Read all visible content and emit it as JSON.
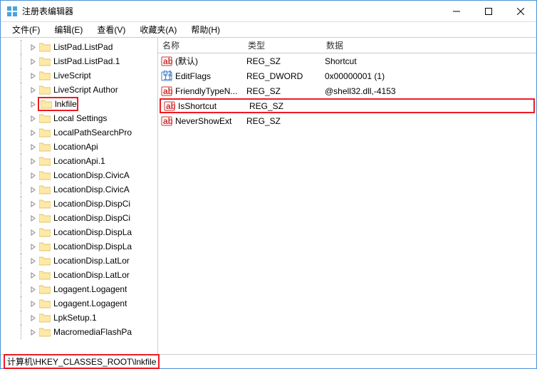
{
  "window": {
    "title": "注册表编辑器"
  },
  "menu": {
    "file": "文件(F)",
    "edit": "编辑(E)",
    "view": "查看(V)",
    "fav": "收藏夹(A)",
    "help": "帮助(H)"
  },
  "tree": [
    {
      "label": "ListPad.ListPad",
      "selected": false
    },
    {
      "label": "ListPad.ListPad.1",
      "selected": false
    },
    {
      "label": "LiveScript",
      "selected": false
    },
    {
      "label": "LiveScript Author",
      "selected": false
    },
    {
      "label": "lnkfile",
      "selected": true,
      "highlight": true
    },
    {
      "label": "Local Settings",
      "selected": false
    },
    {
      "label": "LocalPathSearchPro",
      "selected": false
    },
    {
      "label": "LocationApi",
      "selected": false
    },
    {
      "label": "LocationApi.1",
      "selected": false
    },
    {
      "label": "LocationDisp.CivicA",
      "selected": false
    },
    {
      "label": "LocationDisp.CivicA",
      "selected": false
    },
    {
      "label": "LocationDisp.DispCi",
      "selected": false
    },
    {
      "label": "LocationDisp.DispCi",
      "selected": false
    },
    {
      "label": "LocationDisp.DispLa",
      "selected": false
    },
    {
      "label": "LocationDisp.DispLa",
      "selected": false
    },
    {
      "label": "LocationDisp.LatLor",
      "selected": false
    },
    {
      "label": "LocationDisp.LatLor",
      "selected": false
    },
    {
      "label": "Logagent.Logagent",
      "selected": false
    },
    {
      "label": "Logagent.Logagent",
      "selected": false
    },
    {
      "label": "LpkSetup.1",
      "selected": false
    },
    {
      "label": "MacromediaFlashPa",
      "selected": false
    }
  ],
  "list_header": {
    "name": "名称",
    "type": "类型",
    "data": "数据"
  },
  "values": [
    {
      "icon": "str",
      "name": "(默认)",
      "type": "REG_SZ",
      "data": "Shortcut",
      "highlight": false
    },
    {
      "icon": "bin",
      "name": "EditFlags",
      "type": "REG_DWORD",
      "data": "0x00000001 (1)",
      "highlight": false
    },
    {
      "icon": "str",
      "name": "FriendlyTypeN...",
      "type": "REG_SZ",
      "data": "@shell32.dll,-4153",
      "highlight": false
    },
    {
      "icon": "str",
      "name": "IsShortcut",
      "type": "REG_SZ",
      "data": "",
      "highlight": true
    },
    {
      "icon": "str",
      "name": "NeverShowExt",
      "type": "REG_SZ",
      "data": "",
      "highlight": false
    }
  ],
  "statusbar": {
    "path": "计算机\\HKEY_CLASSES_ROOT\\lnkfile"
  },
  "chart_data": null
}
